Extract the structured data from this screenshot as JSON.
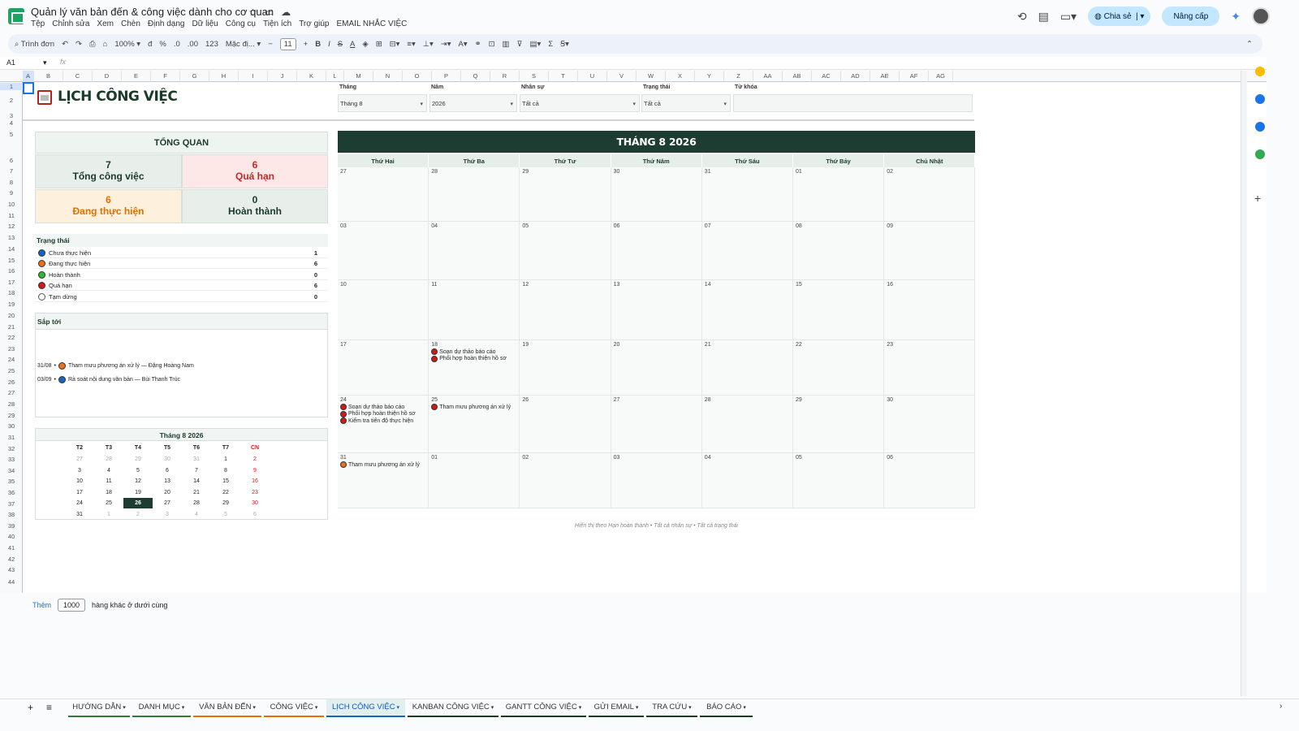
{
  "doc": {
    "title": "Quản lý văn bản đến & công việc dành cho cơ quan"
  },
  "menu": [
    "Tệp",
    "Chỉnh sửa",
    "Xem",
    "Chèn",
    "Định dạng",
    "Dữ liệu",
    "Công cụ",
    "Tiện ích",
    "Trợ giúp",
    "EMAIL NHẮC VIỆC"
  ],
  "header": {
    "share_label": "Chia sẻ",
    "upgrade_label": "Nâng cấp"
  },
  "toolbar": {
    "menus_placeholder": "Trình đơn",
    "zoom": "100%",
    "currency": "đ",
    "percent": "%",
    "dec_less": ".0",
    "dec_more": ".00",
    "format123": "123",
    "font": "Mặc đị...",
    "font_size": "11"
  },
  "formula_bar": {
    "cell_ref": "A1",
    "fx": "fx"
  },
  "columns": [
    "A",
    "B",
    "C",
    "D",
    "E",
    "F",
    "G",
    "H",
    "I",
    "J",
    "K",
    "L",
    "M",
    "N",
    "O",
    "P",
    "Q",
    "R",
    "S",
    "T",
    "U",
    "V",
    "W",
    "X",
    "Y",
    "Z",
    "AA",
    "AB",
    "AC",
    "AD",
    "AE",
    "AF",
    "AG"
  ],
  "rows": [
    "1",
    "2",
    "3",
    "4",
    "5",
    "6",
    "7",
    "8",
    "9",
    "10",
    "11",
    "12",
    "13",
    "14",
    "15",
    "16",
    "17",
    "18",
    "19",
    "20",
    "21",
    "22",
    "23",
    "24",
    "25",
    "26",
    "27",
    "28",
    "29",
    "30",
    "31",
    "32",
    "33",
    "34",
    "35",
    "36",
    "37",
    "38",
    "39",
    "40",
    "41",
    "42",
    "43",
    "44"
  ],
  "page": {
    "title": "LỊCH CÔNG VIỆC"
  },
  "filters": [
    {
      "label": "Tháng",
      "value": "Tháng 8",
      "dropdown": true
    },
    {
      "label": "Năm",
      "value": "2026",
      "dropdown": true
    },
    {
      "label": "Nhân sự",
      "value": "Tất cả",
      "dropdown": true
    },
    {
      "label": "Trạng thái",
      "value": "Tất cả",
      "dropdown": true
    },
    {
      "label": "Từ khóa",
      "value": "",
      "dropdown": false
    }
  ],
  "overview": {
    "title": "TỔNG QUAN",
    "cards": [
      {
        "value": "7",
        "label": "Tổng công việc",
        "color": "#1a3a2a",
        "bg": "#e8efeb"
      },
      {
        "value": "6",
        "label": "Quá hạn",
        "color": "#c62828",
        "bg": "#fde7e7"
      },
      {
        "value": "6",
        "label": "Đang thực hiện",
        "color": "#e07000",
        "bg": "#fdf0dd"
      },
      {
        "value": "0",
        "label": "Hoàn thành",
        "color": "#1a3a2a",
        "bg": "#e8efeb"
      }
    ]
  },
  "status": {
    "title": "Trạng thái",
    "items": [
      {
        "label": "Chưa thực hiện",
        "count": "1",
        "color": "#1565c0"
      },
      {
        "label": "Đang thực hiện",
        "count": "6",
        "color": "#e8711a"
      },
      {
        "label": "Hoàn thành",
        "count": "0",
        "color": "#2eb82e"
      },
      {
        "label": "Quá hạn",
        "count": "6",
        "color": "#d01818"
      },
      {
        "label": "Tạm dừng",
        "count": "0",
        "color": "#ffffff"
      }
    ]
  },
  "upcoming": {
    "title": "Sắp tới",
    "items": [
      {
        "date": "31/08",
        "text": "Tham mưu phương án xử lý — Đặng Hoàng Nam",
        "color": "#e8711a"
      },
      {
        "date": "03/09",
        "text": "Rà soát nội dung văn bản — Bùi Thanh Trúc",
        "color": "#1565c0"
      }
    ]
  },
  "mini_calendar": {
    "title": "Tháng 8 2026",
    "dow": [
      "T2",
      "T3",
      "T4",
      "T5",
      "T6",
      "T7",
      "CN"
    ],
    "weeks": [
      [
        "27",
        "28",
        "29",
        "30",
        "31",
        "1",
        "2"
      ],
      [
        "3",
        "4",
        "5",
        "6",
        "7",
        "8",
        "9"
      ],
      [
        "10",
        "11",
        "12",
        "13",
        "14",
        "15",
        "16"
      ],
      [
        "17",
        "18",
        "19",
        "20",
        "21",
        "22",
        "23"
      ],
      [
        "24",
        "25",
        "26",
        "27",
        "28",
        "29",
        "30"
      ],
      [
        "31",
        "1",
        "2",
        "3",
        "4",
        "5",
        "6"
      ]
    ],
    "today": "26"
  },
  "calendar": {
    "title": "THÁNG 8 2026",
    "dow": [
      "Thứ Hai",
      "Thứ Ba",
      "Thứ Tư",
      "Thứ Năm",
      "Thứ Sáu",
      "Thứ Bảy",
      "Chủ Nhật"
    ],
    "weeks": [
      [
        {
          "d": "27"
        },
        {
          "d": "28"
        },
        {
          "d": "29"
        },
        {
          "d": "30"
        },
        {
          "d": "31"
        },
        {
          "d": "01"
        },
        {
          "d": "02"
        }
      ],
      [
        {
          "d": "03"
        },
        {
          "d": "04"
        },
        {
          "d": "05"
        },
        {
          "d": "06"
        },
        {
          "d": "07"
        },
        {
          "d": "08"
        },
        {
          "d": "09"
        }
      ],
      [
        {
          "d": "10"
        },
        {
          "d": "11"
        },
        {
          "d": "12"
        },
        {
          "d": "13"
        },
        {
          "d": "14"
        },
        {
          "d": "15"
        },
        {
          "d": "16"
        }
      ],
      [
        {
          "d": "17"
        },
        {
          "d": "18",
          "events": [
            {
              "t": "Soạn dự thảo báo cáo",
              "c": "#d01818"
            },
            {
              "t": "Phối hợp hoàn thiện hồ sơ",
              "c": "#d01818"
            }
          ]
        },
        {
          "d": "19"
        },
        {
          "d": "20"
        },
        {
          "d": "21"
        },
        {
          "d": "22"
        },
        {
          "d": "23"
        }
      ],
      [
        {
          "d": "24",
          "events": [
            {
              "t": "Soạn dự thảo báo cáo",
              "c": "#d01818"
            },
            {
              "t": "Phối hợp hoàn thiện hồ sơ",
              "c": "#d01818"
            },
            {
              "t": "Kiểm tra tiến độ thực hiện",
              "c": "#d01818"
            }
          ]
        },
        {
          "d": "25",
          "events": [
            {
              "t": "Tham mưu phương án xử lý",
              "c": "#d01818"
            }
          ]
        },
        {
          "d": "26"
        },
        {
          "d": "27"
        },
        {
          "d": "28"
        },
        {
          "d": "29"
        },
        {
          "d": "30"
        }
      ],
      [
        {
          "d": "31",
          "events": [
            {
              "t": "Tham mưu phương án xử lý",
              "c": "#e8711a"
            }
          ]
        },
        {
          "d": "01"
        },
        {
          "d": "02"
        },
        {
          "d": "03"
        },
        {
          "d": "04"
        },
        {
          "d": "05"
        },
        {
          "d": "06"
        }
      ]
    ],
    "footnote": "Hiển thị theo Hạn hoàn thành • Tất cả nhân sự • Tất cả trạng thái"
  },
  "more_rows": {
    "add_label": "Thêm",
    "count": "1000",
    "suffix": "hàng khác ở dưới cùng"
  },
  "tabs": [
    {
      "label": "HƯỚNG DẪN",
      "color": "#2e7d32"
    },
    {
      "label": "DANH MỤC",
      "color": "#2e7d32"
    },
    {
      "label": "VĂN BẢN ĐẾN",
      "color": "#e07000"
    },
    {
      "label": "CÔNG VIỆC",
      "color": "#e07000"
    },
    {
      "label": "LỊCH CÔNG VIỆC",
      "color": "#1565c0",
      "active": true
    },
    {
      "label": "KANBAN CÔNG VIỆC",
      "color": "#1a3a2a"
    },
    {
      "label": "GANTT CÔNG VIỆC",
      "color": "#1a3a2a"
    },
    {
      "label": "GỬI EMAIL",
      "color": "#1a3a2a"
    },
    {
      "label": "TRA CỨU",
      "color": "#1a3a2a"
    },
    {
      "label": "BÁO CÁO",
      "color": "#1a3a2a"
    }
  ]
}
